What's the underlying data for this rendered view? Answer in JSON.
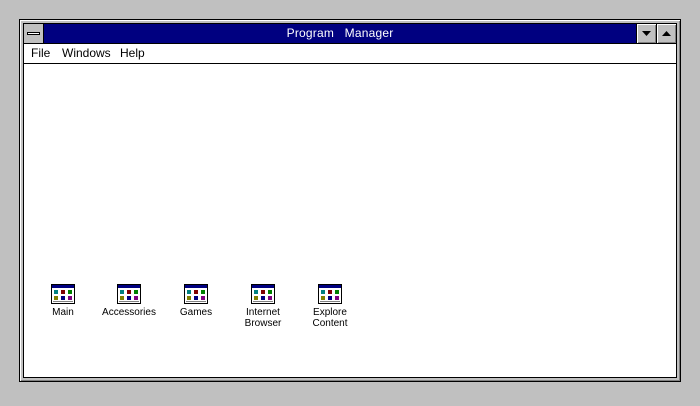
{
  "window": {
    "title": "Program   Manager"
  },
  "menu": [
    {
      "label": "File"
    },
    {
      "label": "Windows"
    },
    {
      "label": "Help"
    }
  ],
  "groups": [
    {
      "label": "Main"
    },
    {
      "label": "Accessories"
    },
    {
      "label": "Games"
    },
    {
      "label": "Internet\nBrowser"
    },
    {
      "label": "Explore\nContent"
    }
  ],
  "colors": {
    "titlebar": "#000080",
    "desktop": "#c0c0c0",
    "client": "#ffffff"
  },
  "icons": {
    "system_menu": "system-menu-icon",
    "minimize": "minimize-arrow-icon",
    "maximize": "maximize-arrow-icon",
    "group": "program-group-icon"
  }
}
